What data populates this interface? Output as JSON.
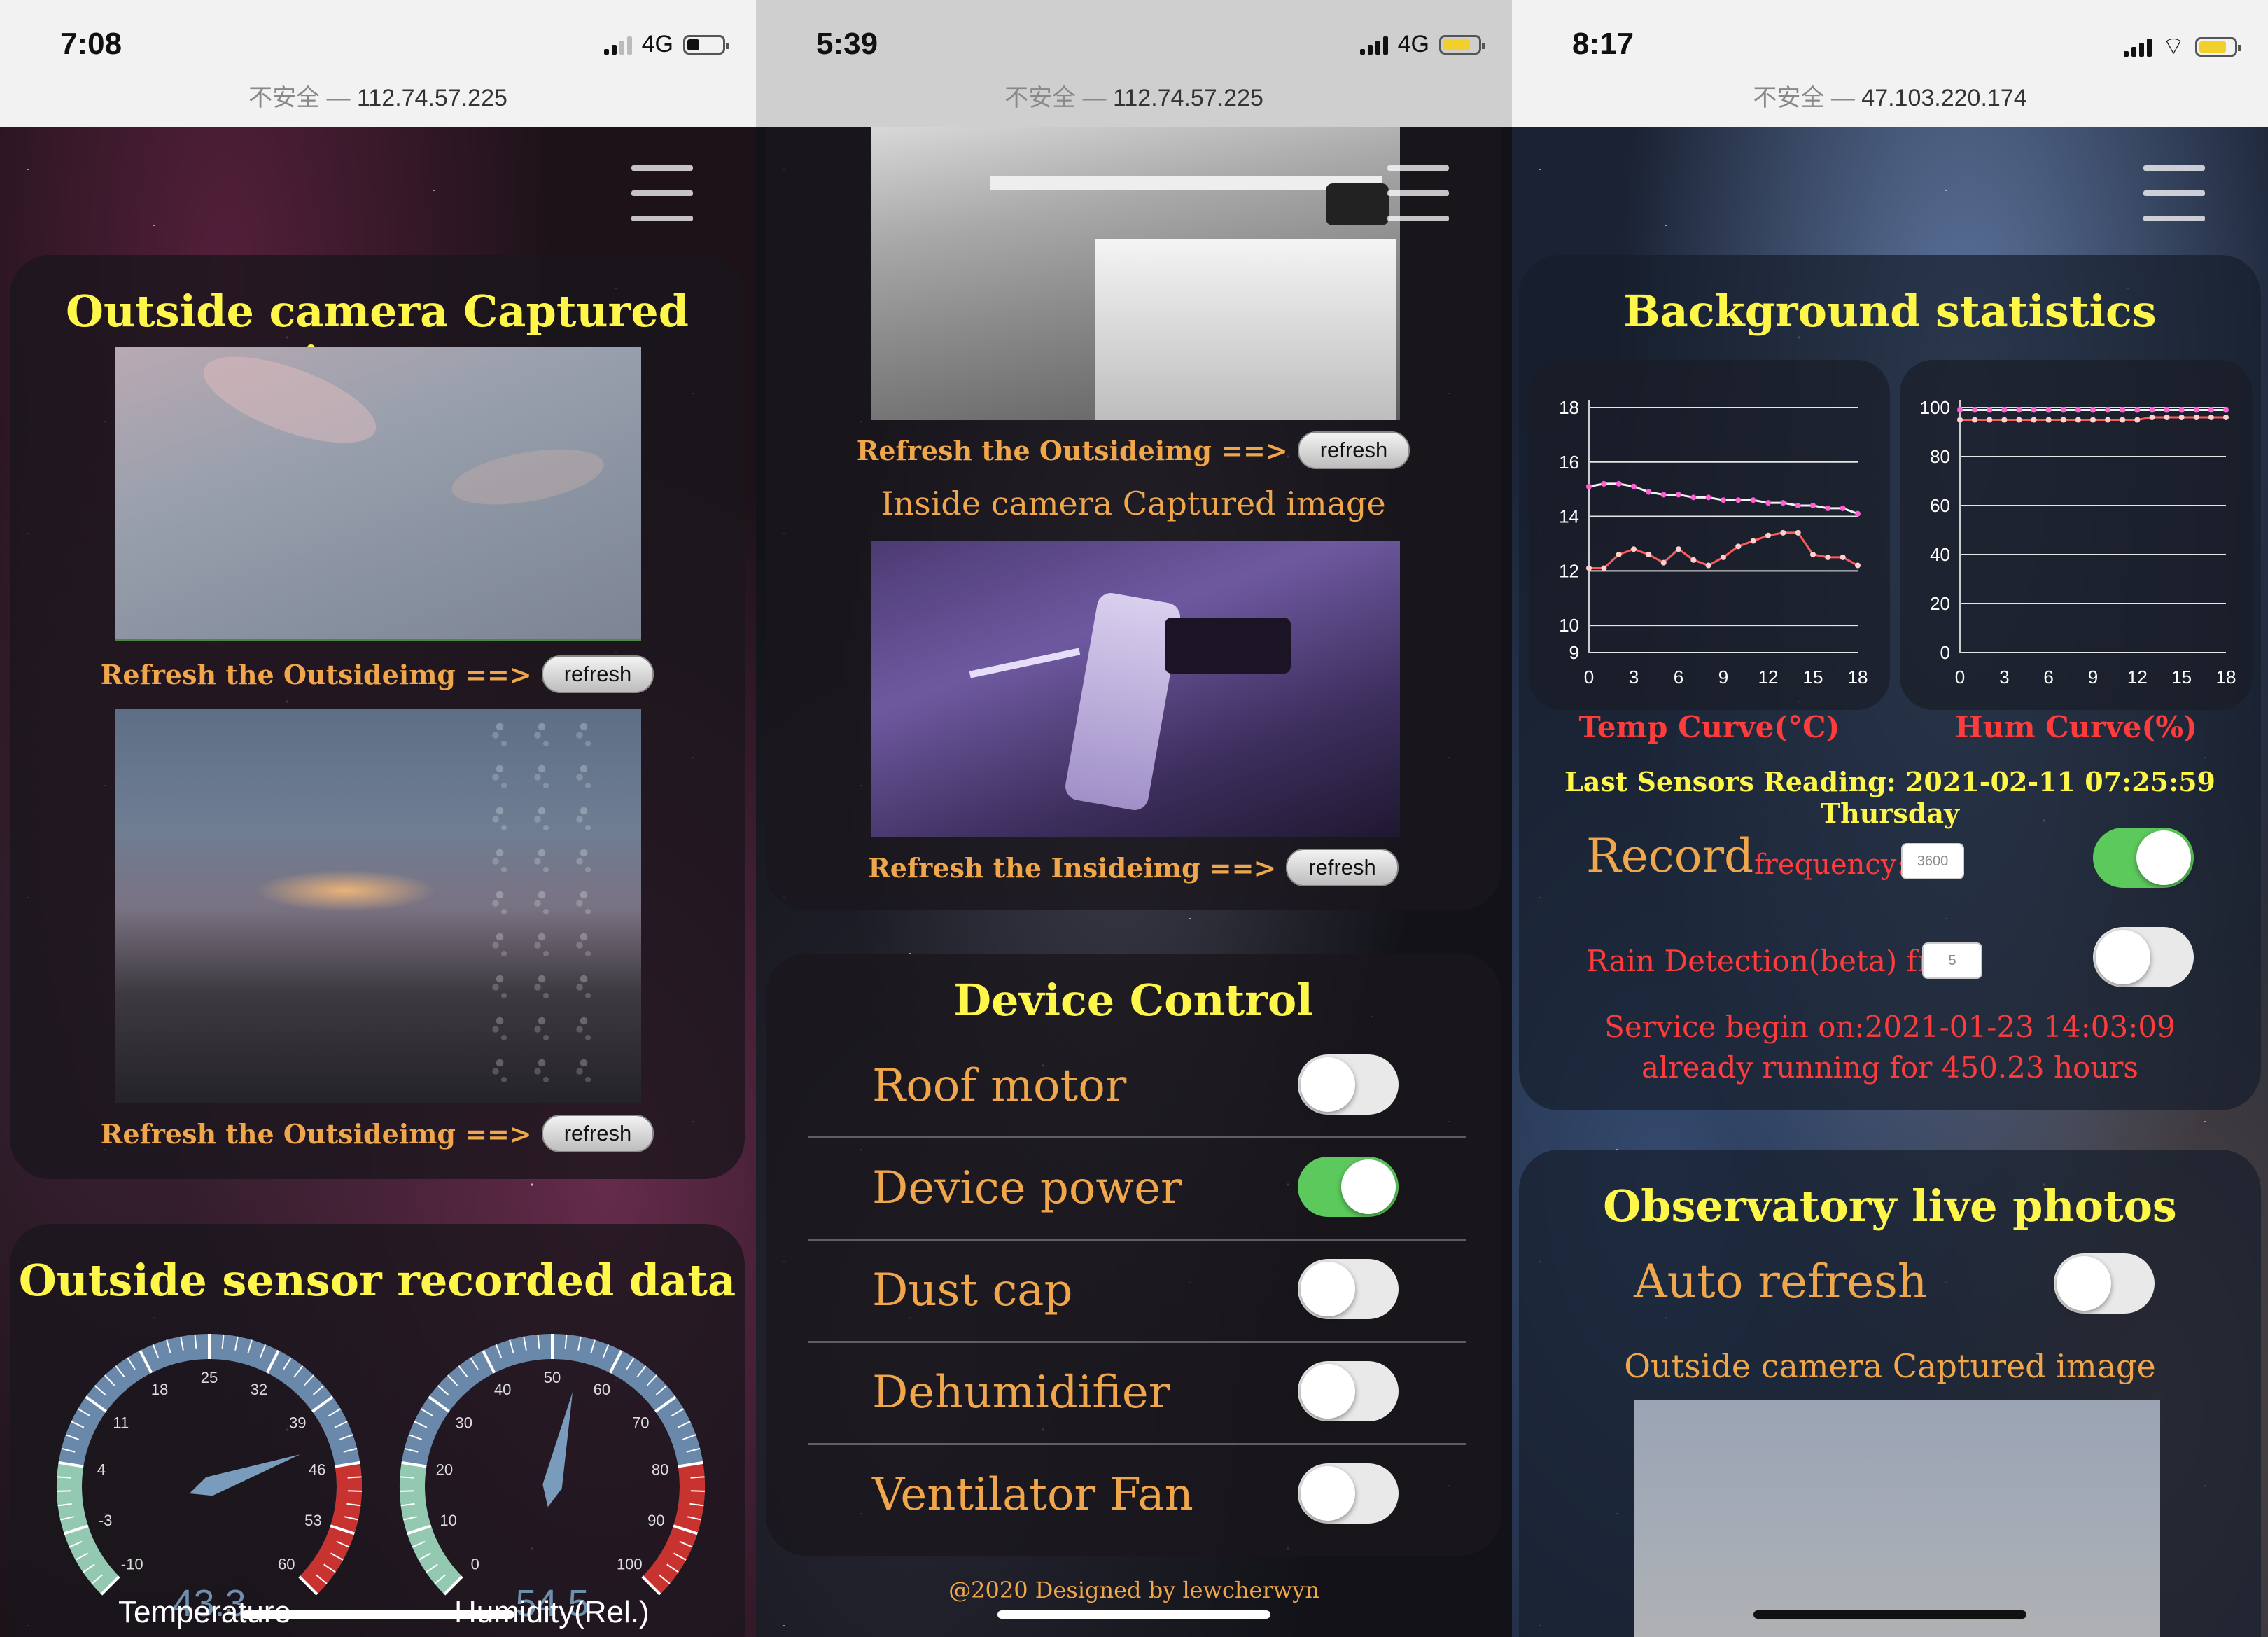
{
  "phone1": {
    "status": {
      "time": "7:08",
      "network": "4G"
    },
    "url": {
      "prefix": "不安全 — ",
      "host": "112.74.57.225"
    },
    "outside_camera": {
      "title": "Outside camera Captured image",
      "refresh_label_1": "Refresh the Outsideimg ==>",
      "refresh_btn_1": "refresh",
      "refresh_label_2": "Refresh the Outsideimg ==>",
      "refresh_btn_2": "refresh"
    },
    "sensor": {
      "title": "Outside sensor recorded data",
      "temperature": {
        "value": "43.3",
        "label": "Temperature",
        "min": -10,
        "max": 60,
        "ticks": [
          "-10",
          "-3",
          "4",
          "11",
          "18",
          "25",
          "32",
          "39",
          "46",
          "53",
          "60"
        ]
      },
      "humidity": {
        "value": "54.5",
        "label": "Humidity(Rel.)",
        "min": 0,
        "max": 100,
        "ticks": [
          "0",
          "10",
          "20",
          "30",
          "40",
          "50",
          "60",
          "70",
          "80",
          "90",
          "100"
        ]
      }
    }
  },
  "phone2": {
    "status": {
      "time": "5:39",
      "network": "4G"
    },
    "url": {
      "prefix": "不安全 — ",
      "host": "112.74.57.225"
    },
    "camera": {
      "refresh_outside_label": "Refresh the Outsideimg ==>",
      "refresh_outside_btn": "refresh",
      "inside_title": "Inside camera Captured image",
      "refresh_inside_label": "Refresh the Insideimg ==>",
      "refresh_inside_btn": "refresh"
    },
    "device_control": {
      "title": "Device Control",
      "items": [
        {
          "label": "Roof motor",
          "on": false
        },
        {
          "label": "Device power",
          "on": true
        },
        {
          "label": "Dust cap",
          "on": false
        },
        {
          "label": "Dehumidifier",
          "on": false
        },
        {
          "label": "Ventilator Fan",
          "on": false
        }
      ]
    },
    "footer": "@2020 Designed by lewcherwyn"
  },
  "phone3": {
    "status": {
      "time": "8:17"
    },
    "url": {
      "prefix": "不安全 — ",
      "host": "47.103.220.174"
    },
    "stats": {
      "title": "Background statistics",
      "temp_caption": "Temp Curve(°C)",
      "hum_caption": "Hum Curve(%)",
      "last_reading": "Last Sensors Reading: 2021-02-11 07:25:59 Thursday",
      "record_label": "Record",
      "frequency_label": "frequency:",
      "frequency_value": "3600",
      "record_on": true,
      "rain_label": "Rain Detection(beta) freq:",
      "rain_value": "5",
      "rain_on": false,
      "service_begin": "Service begin on:2021-01-23 14:03:09",
      "running_for": "already running for 450.23 hours"
    },
    "live": {
      "title": "Observatory live photos",
      "auto_refresh_label": "Auto refresh",
      "auto_refresh_on": false,
      "outside_title": "Outside camera Captured image"
    }
  },
  "chart_data": [
    {
      "type": "line",
      "title": "Temp Curve(°C)",
      "x": [
        0,
        1,
        2,
        3,
        4,
        5,
        6,
        7,
        8,
        9,
        10,
        11,
        12,
        13,
        14,
        15,
        16,
        17,
        18
      ],
      "xticks": [
        "0",
        "3",
        "6",
        "9",
        "12",
        "15",
        "18"
      ],
      "yticks": [
        "9",
        "10",
        "12",
        "14",
        "16",
        "18"
      ],
      "ylim": [
        9,
        18
      ],
      "series": [
        {
          "values": [
            15.1,
            15.2,
            15.2,
            15.1,
            14.9,
            14.8,
            14.8,
            14.7,
            14.7,
            14.6,
            14.6,
            14.6,
            14.5,
            14.5,
            14.4,
            14.4,
            14.3,
            14.3,
            14.1
          ]
        },
        {
          "values": [
            12.1,
            12.1,
            12.6,
            12.8,
            12.6,
            12.3,
            12.8,
            12.4,
            12.2,
            12.5,
            12.9,
            13.1,
            13.3,
            13.4,
            13.4,
            12.6,
            12.5,
            12.5,
            12.2
          ]
        }
      ]
    },
    {
      "type": "line",
      "title": "Hum Curve(%)",
      "x": [
        0,
        1,
        2,
        3,
        4,
        5,
        6,
        7,
        8,
        9,
        10,
        11,
        12,
        13,
        14,
        15,
        16,
        17,
        18
      ],
      "xticks": [
        "0",
        "3",
        "6",
        "9",
        "12",
        "15",
        "18"
      ],
      "yticks": [
        "0",
        "20",
        "40",
        "60",
        "80",
        "100"
      ],
      "ylim": [
        0,
        100
      ],
      "series": [
        {
          "values": [
            99,
            99,
            99,
            99,
            99,
            99,
            99,
            99,
            99,
            99,
            99,
            99,
            99,
            99,
            99,
            99,
            99,
            99,
            99
          ]
        },
        {
          "values": [
            95,
            95,
            95,
            95,
            95,
            95,
            95,
            95,
            95,
            95,
            95,
            95,
            95,
            96,
            96,
            96,
            96,
            96,
            96
          ]
        }
      ]
    }
  ]
}
